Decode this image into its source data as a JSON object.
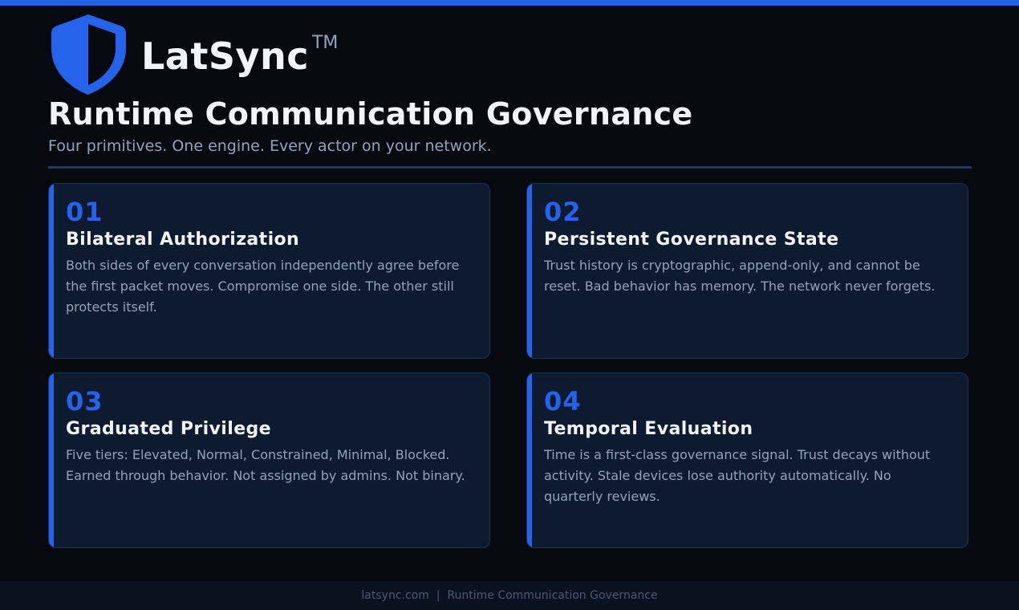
{
  "brand": {
    "name": "LatSync",
    "trademark": "TM",
    "logo_icon": "shield-icon",
    "accent_color": "#2563eb"
  },
  "hero": {
    "title": "Runtime Communication Governance",
    "subtitle": "Four primitives. One engine. Every actor on your network."
  },
  "cards": [
    {
      "number": "01",
      "title": "Bilateral Authorization",
      "body": "Both sides of every conversation independently agree before the first packet moves. Compromise one side. The other still protects itself."
    },
    {
      "number": "02",
      "title": "Persistent Governance State",
      "body": "Trust history is cryptographic, append-only, and cannot be reset. Bad behavior has memory. The network never forgets."
    },
    {
      "number": "03",
      "title": "Graduated Privilege",
      "body": "Five tiers: Elevated, Normal, Constrained, Minimal, Blocked. Earned through behavior. Not assigned by admins. Not binary."
    },
    {
      "number": "04",
      "title": "Temporal Evaluation",
      "body": "Time is a first-class governance signal. Trust decays without activity. Stale devices lose authority automatically. No quarterly reviews."
    }
  ],
  "footer": {
    "text": "latsync.com  |  Runtime Communication Governance"
  }
}
